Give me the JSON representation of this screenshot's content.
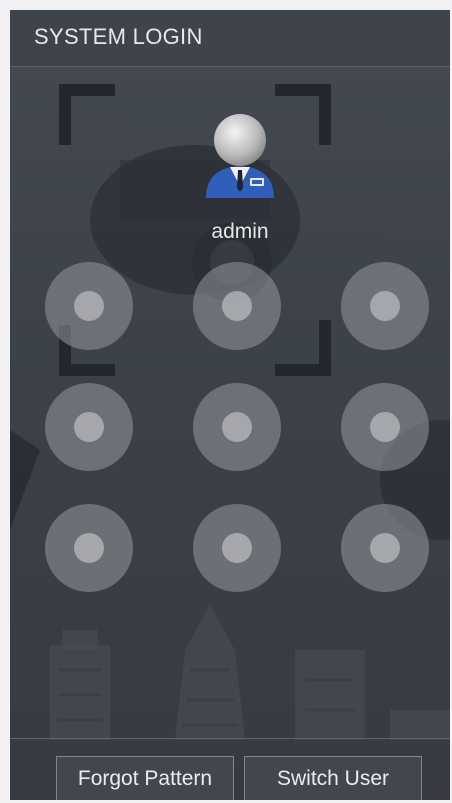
{
  "title": "SYSTEM LOGIN",
  "user": {
    "name": "admin",
    "avatar_icon": "user-avatar-icon"
  },
  "pattern": {
    "dots": [
      1,
      2,
      3,
      4,
      5,
      6,
      7,
      8,
      9
    ]
  },
  "buttons": {
    "forgot_pattern": "Forgot Pattern",
    "switch_user": "Switch User"
  },
  "colors": {
    "panel": "#3d424a",
    "text": "#e8e8ea",
    "avatar_shirt": "#2f5fb8"
  }
}
